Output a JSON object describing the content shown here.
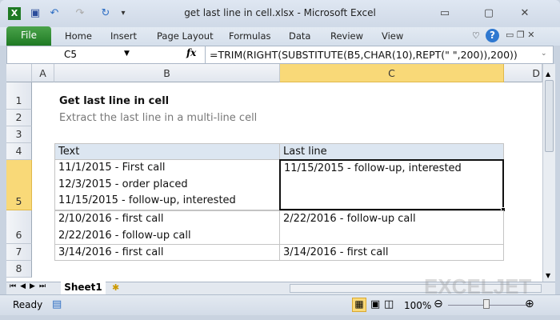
{
  "window": {
    "title": "get last line in cell.xlsx  -  Microsoft Excel"
  },
  "quick_access": {
    "icons": [
      "excel-logo-icon",
      "save-icon",
      "undo-icon",
      "redo-icon",
      "refresh-icon",
      "customize-icon"
    ]
  },
  "ribbon": {
    "file": "File",
    "tabs": [
      "Home",
      "Insert",
      "Page Layout",
      "Formulas",
      "Data",
      "Review",
      "View"
    ]
  },
  "formula_bar": {
    "name_box": "C5",
    "fx": "fx",
    "formula": "=TRIM(RIGHT(SUBSTITUTE(B5,CHAR(10),REPT(\" \",200)),200))"
  },
  "columns": [
    "A",
    "B",
    "C",
    "D"
  ],
  "rows": [
    "1",
    "2",
    "3",
    "4",
    "5",
    "6",
    "7",
    "8"
  ],
  "sheet": {
    "title": "Get last line in cell",
    "subtitle": "Extract the last line in a multi-line cell",
    "headers": [
      "Text",
      "Last line"
    ],
    "data": [
      {
        "text": "11/1/2015 - First call\n12/3/2015 - order placed\n11/15/2015 - follow-up, interested",
        "last": "11/15/2015 - follow-up, interested"
      },
      {
        "text": "2/10/2016 - first call\n2/22/2016 - follow-up call",
        "last": "2/22/2016 - follow-up call"
      },
      {
        "text": "3/14/2016 - first call",
        "last": "3/14/2016 - first call"
      }
    ]
  },
  "tabs": {
    "sheet1": "Sheet1"
  },
  "status": {
    "ready": "Ready",
    "zoom": "100%"
  },
  "watermark": "EXCELJET",
  "colors": {
    "accent": "#1f7a24",
    "selected_header": "#f9d978",
    "table_header": "#dce6f1"
  }
}
